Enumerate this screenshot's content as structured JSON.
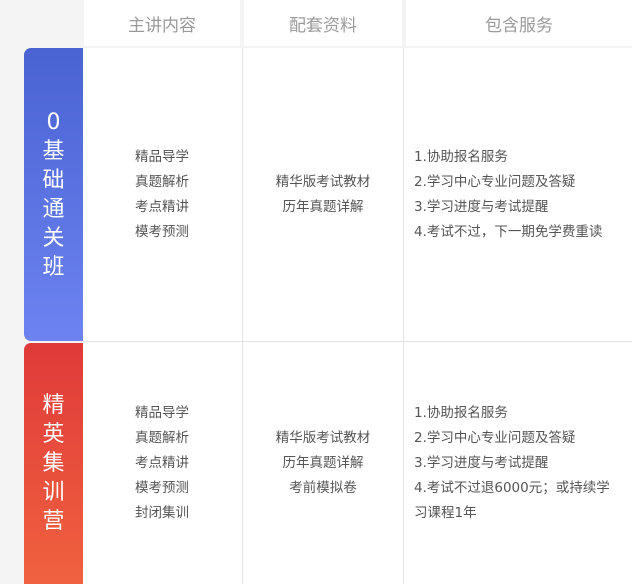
{
  "headers": [
    "主讲内容",
    "配套资料",
    "包含服务"
  ],
  "colors": {
    "blue_badge": "#5470e2",
    "red_badge": "#e84a3b"
  },
  "rows": [
    {
      "badge": [
        "0",
        "基",
        "础",
        "通",
        "关",
        "班"
      ],
      "content": [
        "精品导学",
        "真题解析",
        "考点精讲",
        "模考预测"
      ],
      "materials": [
        "精华版考试教材",
        "历年真题详解"
      ],
      "services": [
        "1.协助报名服务",
        "2.学习中心专业问题及答疑",
        "3.学习进度与考试提醒",
        "4.考试不过，下一期免学费重读"
      ]
    },
    {
      "badge": [
        "精",
        "英",
        "集",
        "训",
        "营"
      ],
      "content": [
        "精品导学",
        "真题解析",
        "考点精讲",
        "模考预测",
        "封闭集训"
      ],
      "materials": [
        "精华版考试教材",
        "历年真题详解",
        "考前模拟卷"
      ],
      "services": [
        "1.协助报名服务",
        "2.学习中心专业问题及答疑",
        "3.学习进度与考试提醒",
        "4.考试不过退6000元；或持续学",
        "习课程1年"
      ]
    }
  ]
}
